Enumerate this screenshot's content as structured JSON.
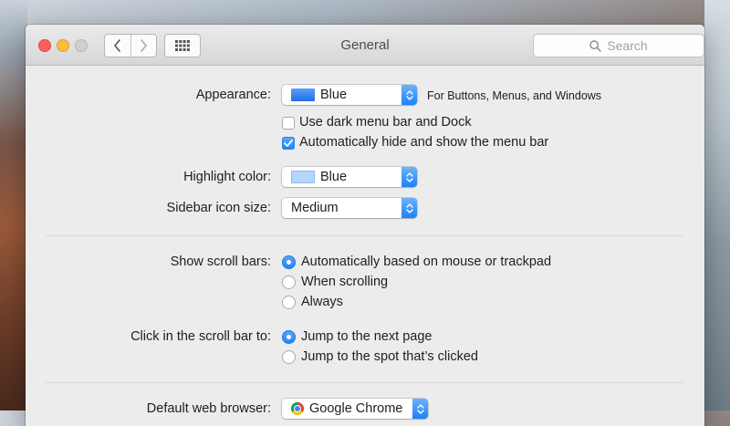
{
  "window": {
    "title": "General"
  },
  "toolbar": {
    "back_icon": "chevron-left-icon",
    "forward_icon": "chevron-right-icon",
    "show_all_icon": "grid-icon",
    "search_placeholder": "Search"
  },
  "appearance": {
    "label": "Appearance:",
    "value": "Blue",
    "swatch_color": "#2b7bf3",
    "note": "For Buttons, Menus, and Windows"
  },
  "options": {
    "dark_menu": {
      "label": "Use dark menu bar and Dock",
      "checked": false
    },
    "auto_hide": {
      "label": "Automatically hide and show the menu bar",
      "checked": true
    }
  },
  "highlight": {
    "label": "Highlight color:",
    "value": "Blue",
    "swatch_color": "#b4d6fb"
  },
  "sidebar_icon": {
    "label": "Sidebar icon size:",
    "value": "Medium"
  },
  "scroll_bars": {
    "label": "Show scroll bars:",
    "options": [
      "Automatically based on mouse or trackpad",
      "When scrolling",
      "Always"
    ],
    "selected": 0
  },
  "scroll_click": {
    "label": "Click in the scroll bar to:",
    "options": [
      "Jump to the next page",
      "Jump to the spot that’s clicked"
    ],
    "selected": 0
  },
  "browser": {
    "label": "Default web browser:",
    "value": "Google Chrome"
  },
  "colors": {
    "accent": "#1c81fb"
  }
}
